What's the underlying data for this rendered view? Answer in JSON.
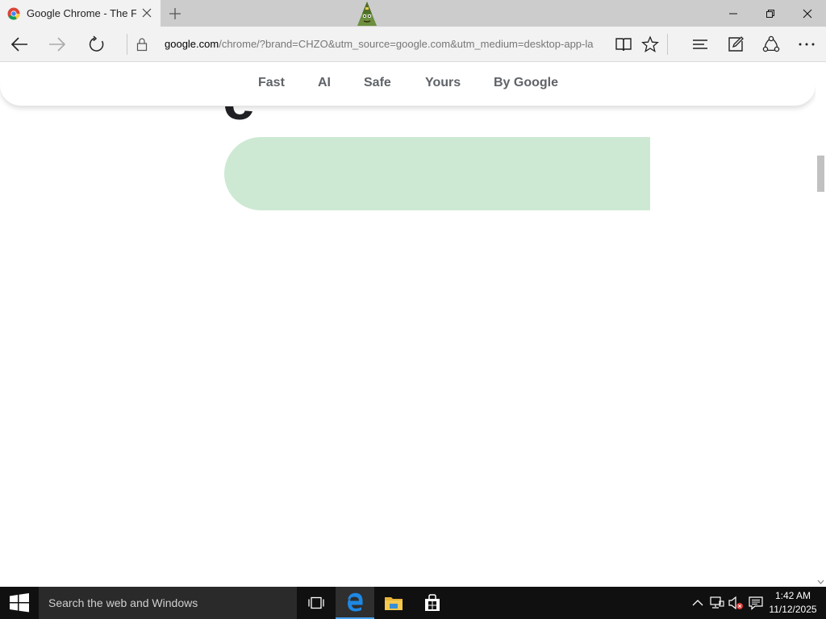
{
  "browser": {
    "tab": {
      "title": "Google Chrome - The Fast & Secure Web Browser Built to be Yours",
      "favicon": "chrome-logo-icon",
      "close_icon": "close-icon"
    },
    "new_tab_icon": "plus-icon",
    "window_controls": {
      "minimize": "minimize-icon",
      "restore": "restore-icon",
      "close": "close-icon"
    },
    "nav": {
      "back": "back-arrow-icon",
      "forward": "forward-arrow-icon",
      "refresh": "refresh-icon",
      "lock": "lock-icon",
      "url_host": "google.com",
      "url_rest": "/chrome/?brand=CHZO&utm_source=google.com&utm_medium=desktop-app-la",
      "reading_view": "book-icon",
      "favorites": "star-icon",
      "hub": "hub-lines-icon",
      "web_note": "pen-square-icon",
      "share": "share-icon",
      "more": "more-dots-icon"
    }
  },
  "page": {
    "big_letter": "e",
    "sticky_nav": [
      "Fast",
      "AI",
      "Safe",
      "Yours",
      "By Google"
    ],
    "pill_color": "#cde9d3"
  },
  "taskbar": {
    "start_icon": "windows-logo-icon",
    "search_placeholder": "Search the web and Windows",
    "task_view_icon": "task-view-icon",
    "apps": [
      "edge-icon",
      "file-explorer-icon",
      "store-icon"
    ],
    "tray": [
      "chevron-up-icon",
      "network-icon",
      "volume-muted-icon",
      "notification-icon"
    ],
    "time": "1:42 AM",
    "date": "11/12/2025"
  },
  "colors": {
    "chrome_bg": "#f2f2f2",
    "titlebar_bg": "#cccccc",
    "taskbar_bg": "#101010",
    "nav_text": "#5f6368",
    "edge_blue": "#1e88e5"
  }
}
